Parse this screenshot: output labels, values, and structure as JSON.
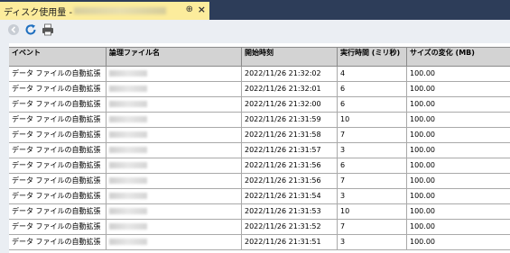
{
  "tab": {
    "title": "ディスク使用量 -",
    "pin_glyph": "⊕",
    "close_glyph": "×"
  },
  "toolbar": {
    "buttons": [
      {
        "icon": "back-arrow-icon"
      },
      {
        "icon": "refresh-icon"
      },
      {
        "icon": "print-icon"
      }
    ]
  },
  "table": {
    "headers": [
      "イベント",
      "論理ファイル名",
      "開始時刻",
      "実行時間 (ミリ秒)",
      "サイズの変化 (MB)"
    ],
    "rows": [
      {
        "event": "データ ファイルの自動拡張",
        "start": "2022/11/26 21:32:02",
        "duration": "4",
        "change": "100.00"
      },
      {
        "event": "データ ファイルの自動拡張",
        "start": "2022/11/26 21:32:01",
        "duration": "6",
        "change": "100.00"
      },
      {
        "event": "データ ファイルの自動拡張",
        "start": "2022/11/26 21:32:00",
        "duration": "6",
        "change": "100.00"
      },
      {
        "event": "データ ファイルの自動拡張",
        "start": "2022/11/26 21:31:59",
        "duration": "10",
        "change": "100.00"
      },
      {
        "event": "データ ファイルの自動拡張",
        "start": "2022/11/26 21:31:58",
        "duration": "7",
        "change": "100.00"
      },
      {
        "event": "データ ファイルの自動拡張",
        "start": "2022/11/26 21:31:57",
        "duration": "3",
        "change": "100.00"
      },
      {
        "event": "データ ファイルの自動拡張",
        "start": "2022/11/26 21:31:56",
        "duration": "6",
        "change": "100.00"
      },
      {
        "event": "データ ファイルの自動拡張",
        "start": "2022/11/26 21:31:56",
        "duration": "7",
        "change": "100.00"
      },
      {
        "event": "データ ファイルの自動拡張",
        "start": "2022/11/26 21:31:54",
        "duration": "3",
        "change": "100.00"
      },
      {
        "event": "データ ファイルの自動拡張",
        "start": "2022/11/26 21:31:53",
        "duration": "10",
        "change": "100.00"
      },
      {
        "event": "データ ファイルの自動拡張",
        "start": "2022/11/26 21:31:52",
        "duration": "7",
        "change": "100.00"
      },
      {
        "event": "データ ファイルの自動拡張",
        "start": "2022/11/26 21:31:51",
        "duration": "3",
        "change": "100.00"
      }
    ]
  },
  "colors": {
    "tab_active": "#fcec9c",
    "tabstrip": "#2d3d59",
    "header_bg": "#d3d3d3",
    "refresh_icon": "#1f6fbf"
  }
}
